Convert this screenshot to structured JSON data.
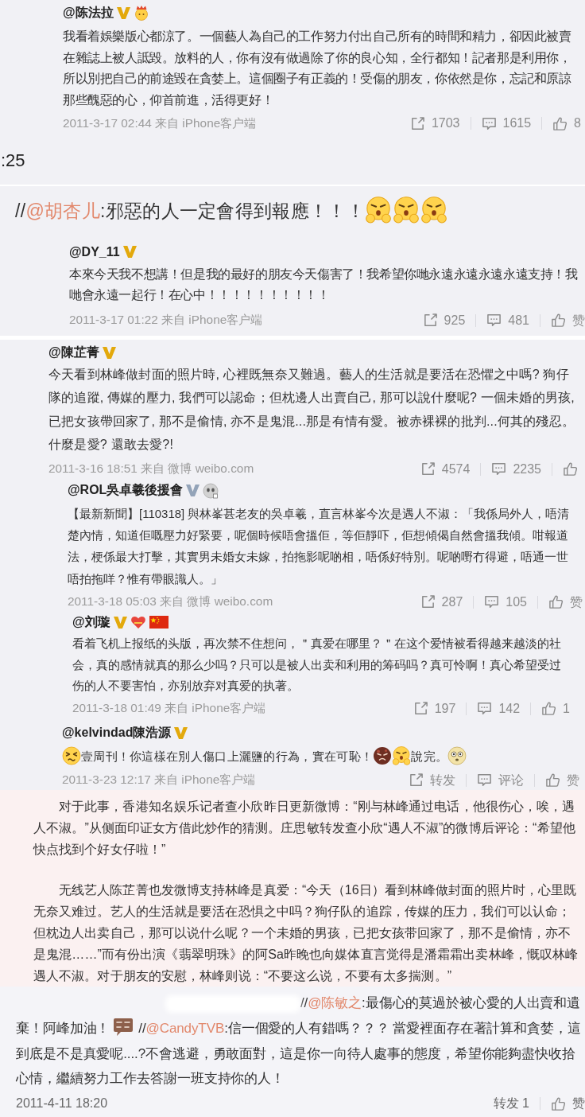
{
  "blocks": [
    {
      "kind": "post",
      "author": "@陈法拉",
      "verified": {
        "color": "#e3a90c"
      },
      "badges": [
        {
          "kind": "crown"
        }
      ],
      "segments": [
        {
          "kind": "text",
          "text": "我看着娛樂版心都涼了。一個藝人為自己的工作努力付出自己所有的時間和精力，卻因此被賣在雜誌上被人詆毀。放料的人，你有沒有做過除了你的良心知，全行都知！記者那是利用你，所以別把自己的前途毀在貪婪上。這個圈子有正義的！受傷的朋友，你依然是你，忘記和原諒那些醜惡的心，仰首前進，活得更好！"
        }
      ],
      "meta": "2011-3-17 02:44 来自 iPhone客户端",
      "actions": [
        {
          "kind": "repost",
          "label": "1703"
        },
        {
          "kind": "comment",
          "label": "1615"
        },
        {
          "kind": "like",
          "label": "8"
        }
      ]
    },
    {
      "kind": "fragment",
      "text": ":25"
    },
    {
      "kind": "quote",
      "segments": [
        {
          "kind": "text",
          "text": "//"
        },
        {
          "kind": "mention",
          "text": "@胡杏儿"
        },
        {
          "kind": "text",
          "text": ":邪惡的人一定會得到報應！！！"
        },
        {
          "kind": "huff"
        },
        {
          "kind": "huff"
        },
        {
          "kind": "huff"
        }
      ]
    },
    {
      "kind": "post",
      "author": "@DY_11",
      "verified": {
        "color": "#e3a90c"
      },
      "segments": [
        {
          "kind": "text",
          "text": "本來今天我不想講！但是我的最好的朋友今天傷害了！我希望你哋永遠永遠永遠永遠支持！我哋會永遠一起行！在心中！！！！！！！！！！"
        }
      ],
      "meta": "2011-3-17 01:22 来自 iPhone客户端",
      "actions": [
        {
          "kind": "repost",
          "label": "925"
        },
        {
          "kind": "comment",
          "label": "481"
        },
        {
          "kind": "like",
          "label": "赞"
        }
      ]
    },
    {
      "kind": "post",
      "author": "@陳芷菁",
      "verified": {
        "color": "#e3a90c"
      },
      "segments": [
        {
          "kind": "text",
          "text": "今天看到林峰做封面的照片時, 心裡既無奈又難過。藝人的生活就是要活在恐懼之中嗎? 狗仔隊的追蹤, 傳媒的壓力, 我們可以認命；但枕邊人出賣自己, 那可以說什麼呢? 一個未婚的男孩, 已把女孩帶回家了, 那不是偷情, 亦不是鬼混...那是有情有愛。被赤裸裸的批判...何其的殘忍。什麼是愛? 還敢去愛?!"
        }
      ],
      "meta": "2011-3-16 18:51 来自 微博 weibo.com",
      "actions": [
        {
          "kind": "repost",
          "label": "4574"
        },
        {
          "kind": "comment",
          "label": "2235"
        },
        {
          "kind": "like"
        }
      ]
    },
    {
      "kind": "post",
      "author": "@ROL吳卓羲後援會",
      "verified": {
        "color": "#93a3b8"
      },
      "badges": [
        {
          "kind": "face"
        }
      ],
      "segments": [
        {
          "kind": "text",
          "text": "【最新新聞】[110318] 與林峯甚老友的吳卓羲，直言林峯今次是遇人不淑：「我係局外人，唔清楚內情，知道佢嘅壓力好緊要，呢個時候唔會搵佢，等佢靜吓，佢想傾偈自然會搵我傾。咁報道法，梗係最大打擊，其實男未婚女未嫁，拍拖影呢啲相，唔係好特別。呢啲嘢冇得避，唔通一世唔拍拖咩？惟有帶眼識人。」"
        }
      ],
      "meta": "2011-3-18 05:03 来自 微博 weibo.com",
      "actions": [
        {
          "kind": "repost",
          "label": "287"
        },
        {
          "kind": "comment",
          "label": "105"
        },
        {
          "kind": "like",
          "label": "赞"
        }
      ]
    },
    {
      "kind": "post",
      "author": "@刘璇",
      "verified": {
        "color": "#e3a90c"
      },
      "badges": [
        {
          "kind": "vip"
        },
        {
          "kind": "flag"
        }
      ],
      "segments": [
        {
          "kind": "text",
          "text": "看着飞机上报纸的头版，再次禁不住想问，＂真爱在哪里？＂在这个爱情被看得越来越淡的社会，真的感情就真的那么少吗？只可以是被人出卖和利用的筹码吗？真可怜啊！真心希望受过伤的人不要害怕，亦别放弃对真爱的执著。"
        }
      ],
      "meta": "2011-3-18 01:49 来自 iPhone客户端",
      "actions": [
        {
          "kind": "repost",
          "label": "197"
        },
        {
          "kind": "comment",
          "label": "142"
        },
        {
          "kind": "like",
          "label": "1"
        }
      ]
    },
    {
      "kind": "post",
      "author": "@kelvindad陳浩源",
      "verified": {
        "color": "#e3a90c"
      },
      "segments": [
        {
          "kind": "grumpy"
        },
        {
          "kind": "text",
          "text": "壹周刊！你這樣在別人傷口上灑鹽的行為，實在可恥！"
        },
        {
          "kind": "angry"
        },
        {
          "kind": "huff"
        },
        {
          "kind": "text",
          "text": "說完。"
        },
        {
          "kind": "shock"
        }
      ],
      "meta": "2011-3-23 12:17 来自 iPhone客户端",
      "actions": [
        {
          "kind": "repost",
          "label": "转发"
        },
        {
          "kind": "comment",
          "label": "评论"
        },
        {
          "kind": "like",
          "label": "赞"
        }
      ]
    },
    {
      "kind": "article",
      "paragraphs": [
        "对于此事，香港知名娱乐记者查小欣昨日更新微博：“刚与林峰通过电话，他很伤心，唉，遇人不淑。”从侧面印证女方借此炒作的猜测。庄思敏转发查小欣“遇人不淑”的微博后评论：“希望他快点找到个好女仔啦！”",
        "无线艺人陈芷菁也发微博支持林峰是真爱：“今天（16日）看到林峰做封面的照片时，心里既无奈又难过。艺人的生活就是要活在恐惧之中吗？狗仔队的追踪，传媒的压力，我们可以认命；但枕边人出卖自己，那可以说什么呢？一个未婚的男孩，已把女孩带回家了，那不是偷情，亦不是鬼混……”而有份出演《翡翠明珠》的阿Sa昨晚也向媒体直言觉得是潘霜霜出卖林峰，慨叹林峰遇人不淑。对于朋友的安慰，林峰则说：“不要这么说，不要有太多揣测。”"
      ]
    },
    {
      "kind": "comment",
      "segments": [
        {
          "kind": "blur"
        },
        {
          "kind": "text",
          "text": "//"
        },
        {
          "kind": "mention",
          "text": "@陈敏之"
        },
        {
          "kind": "text",
          "text": ":最傷心的莫過於被心愛的人出賣和遺棄！阿峰加油！"
        },
        {
          "kind": "geili"
        },
        {
          "kind": "text",
          "text": "//"
        },
        {
          "kind": "mention",
          "text": "@CandyTVB"
        },
        {
          "kind": "text",
          "text": ":信一個愛的人有錯嗎？？？ 當愛裡面存在著計算和貪婪，這到底是不是真愛呢....?不會逃避，勇敢面對，這是你一向待人處事的態度，希望你能夠盡快收拾心情，繼續努力工作去答謝一班支持你的人！"
        }
      ],
      "meta": "2011-4-11 18:20",
      "actions": [
        {
          "kind": "plain",
          "label": "转发 1"
        },
        {
          "kind": "like",
          "label": "赞"
        }
      ]
    }
  ]
}
